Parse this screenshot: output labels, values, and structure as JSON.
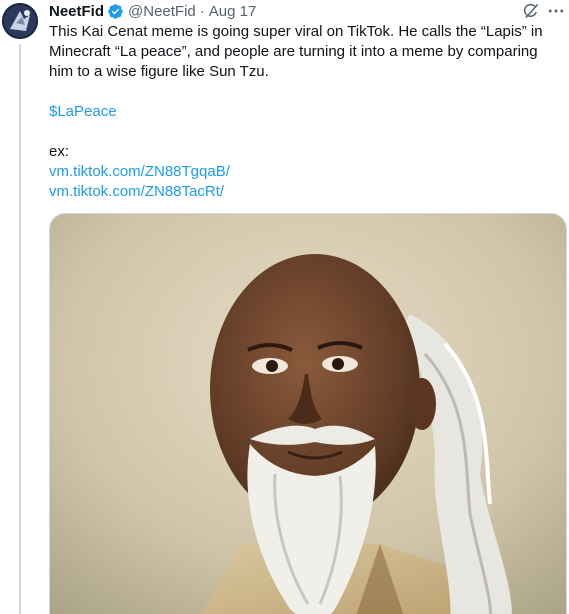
{
  "tweet": {
    "author_name": "NeetFid",
    "handle": "@NeetFid",
    "separator": "·",
    "date": "Aug 17",
    "text": "This Kai Cenat meme is going super viral on TikTok. He calls the “Lapis” in Minecraft “La peace”, and people are turning it into a meme by comparing him to a wise figure like Sun Tzu.",
    "cashtag": "$LaPeace",
    "ex_label": "ex:",
    "links": [
      "vm.tiktok.com/ZN88TgqaB/",
      "vm.tiktok.com/ZN88TacRt/"
    ]
  },
  "icons": {
    "verified": "verified-badge-icon",
    "grok": "grok-icon",
    "more": "more-options-icon"
  },
  "colors": {
    "link": "#1d9bf0",
    "secondary_text": "#536471",
    "verified": "#1d9bf0"
  }
}
